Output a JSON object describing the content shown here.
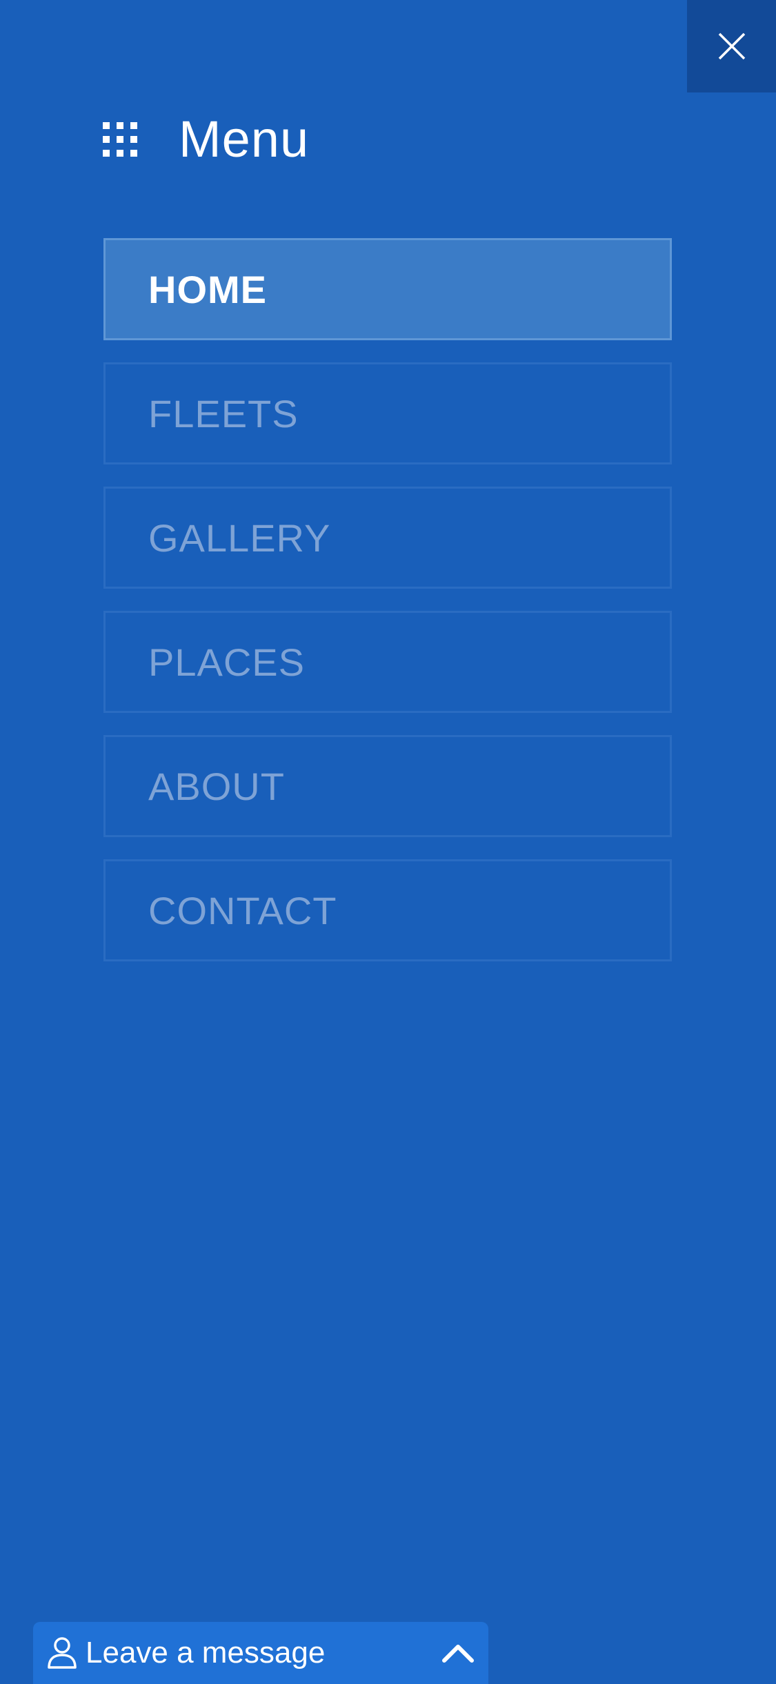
{
  "menu": {
    "title": "Menu"
  },
  "nav": {
    "items": [
      {
        "label": "HOME",
        "active": true
      },
      {
        "label": "FLEETS",
        "active": false
      },
      {
        "label": "GALLERY",
        "active": false
      },
      {
        "label": "PLACES",
        "active": false
      },
      {
        "label": "ABOUT",
        "active": false
      },
      {
        "label": "CONTACT",
        "active": false
      }
    ]
  },
  "chat": {
    "label": "Leave a message"
  },
  "icons": {
    "close": "close-icon",
    "grid": "grid-icon",
    "person": "person-icon",
    "chevron": "chevron-up-icon"
  },
  "colors": {
    "background": "#195fba",
    "close_bg": "#124a98",
    "active_item_bg": "#3b7cc7",
    "inactive_text": "#7ea3d6",
    "chat_bar_bg": "#2071d6"
  }
}
